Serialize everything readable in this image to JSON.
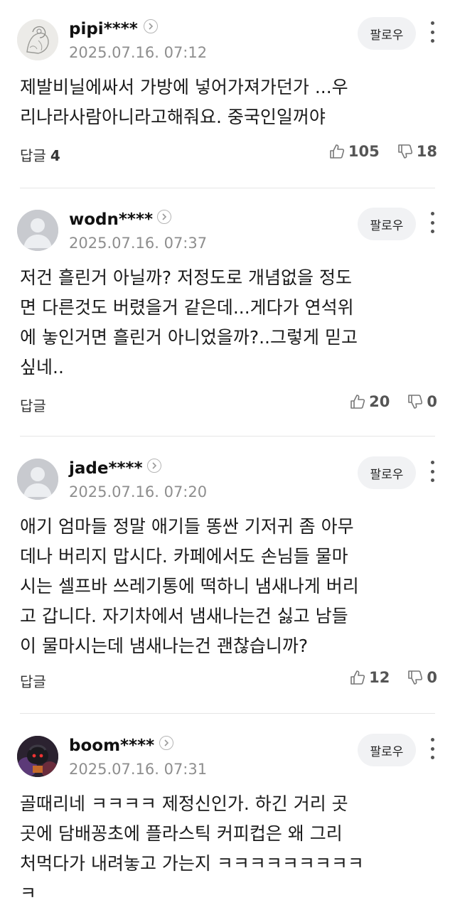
{
  "follow_label": "팔로우",
  "reply_label": "답글",
  "comments": [
    {
      "username": "pipi****",
      "date": "2025.07.16. 07:12",
      "lines": [
        "제발비닐에싸서 가방에 넣어가져가던가 ...우",
        "리나라사람아니라고해줘요. 중국인일꺼야"
      ],
      "reply_count": "4",
      "likes": "105",
      "dislikes": "18",
      "avatar": "sketch"
    },
    {
      "username": "wodn****",
      "date": "2025.07.16. 07:37",
      "lines": [
        "저건 흘린거 아닐까? 저정도로 개념없을 정도",
        "면 다른것도 버렸을거 같은데...게다가 연석위",
        "에 놓인거면 흘린거 아니었을까?..그렇게 믿고",
        "싶네.."
      ],
      "reply_count": "",
      "likes": "20",
      "dislikes": "0",
      "avatar": "default"
    },
    {
      "username": "jade****",
      "date": "2025.07.16. 07:20",
      "lines": [
        "애기 엄마들 정말 애기들 똥싼 기저귀 좀 아무",
        "데나 버리지 맙시다. 카페에서도 손님들 물마",
        "시는 셀프바 쓰레기통에 떡하니 냄새나게 버리",
        "고 갑니다. 자기차에서 냄새나는건 싫고 남들",
        "이 물마시는데 냄새나는건 괜찮습니까?"
      ],
      "reply_count": "",
      "likes": "12",
      "dislikes": "0",
      "avatar": "default"
    },
    {
      "username": "boom****",
      "date": "2025.07.16. 07:31",
      "lines": [
        "골때리네 ㅋㅋㅋㅋ 제정신인가. 하긴 거리 곳",
        "곳에 담배꽁초에 플라스틱 커피컵은 왜 그리",
        "처먹다가 내려놓고 가는지 ㅋㅋㅋㅋㅋㅋㅋㅋㅋ",
        "ㅋ"
      ],
      "reply_count": "",
      "likes": "",
      "dislikes": "",
      "avatar": "game"
    }
  ]
}
